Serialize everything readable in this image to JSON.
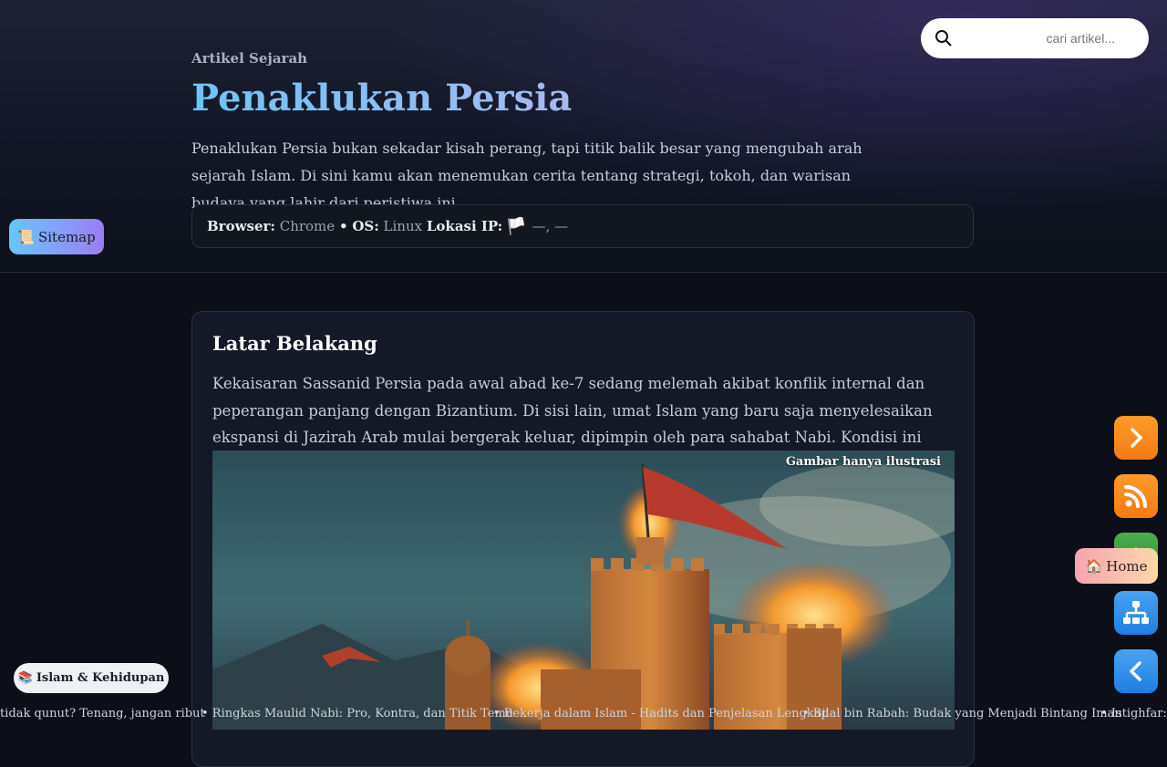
{
  "header": {
    "eyebrow": "Artikel Sejarah",
    "title": "Penaklukan Persia",
    "intro": "Penaklukan Persia bukan sekadar kisah perang, tapi titik balik besar yang mengubah arah sejarah Islam. Di sini kamu akan menemukan cerita tentang strategi, tokoh, dan warisan budaya yang lahir dari peristiwa ini."
  },
  "info": {
    "browser_label": "Browser:",
    "browser_value": "Chrome",
    "sep": "•",
    "os_label": "OS:",
    "os_value": "Linux",
    "ip_label": "Lokasi IP:",
    "flag": "🏳️",
    "ip_value": "—, —"
  },
  "search": {
    "placeholder": "cari artikel..."
  },
  "sitemap": {
    "icon": "📜",
    "label": "Sitemap"
  },
  "section": {
    "heading": "Latar Belakang",
    "body": "Kekaisaran Sassanid Persia pada awal abad ke-7 sedang melemah akibat konflik internal dan peperangan panjang dengan Bizantium. Di sisi lain, umat Islam yang baru saja menyelesaikan ekspansi di Jazirah Arab mulai bergerak keluar, dipimpin oleh para sahabat Nabi. Kondisi ini membuka jalan bagi pertemuan dua kekuatan besar.",
    "image_caption": "Gambar hanya ilustrasi"
  },
  "floating": {
    "home_icon": "🏠",
    "home_label": "Home",
    "buttons": [
      "chevron-right-icon",
      "rss-icon",
      "home-icon",
      "sitemap-tree-icon",
      "chevron-left-icon"
    ]
  },
  "category": {
    "icon": "📚",
    "label": "Islam & Kehidupan"
  },
  "ticker": {
    "items": [
      "tidak qunut? Tenang, jangan ribut",
      "• Ringkas Maulid Nabi: Pro, Kontra, dan Titik Temu",
      "• Bekerja dalam Islam - Hadits dan Penjelasan Lengkap",
      "• Bilal bin Rabah: Budak yang Menjadi Bintang Iman",
      "• Istighfar: K"
    ]
  },
  "colors": {
    "accent_orange": "#f47a12",
    "accent_blue": "#1d7fe0",
    "accent_green": "#2e8b35",
    "title_gradient_start": "#6cc4f5"
  }
}
